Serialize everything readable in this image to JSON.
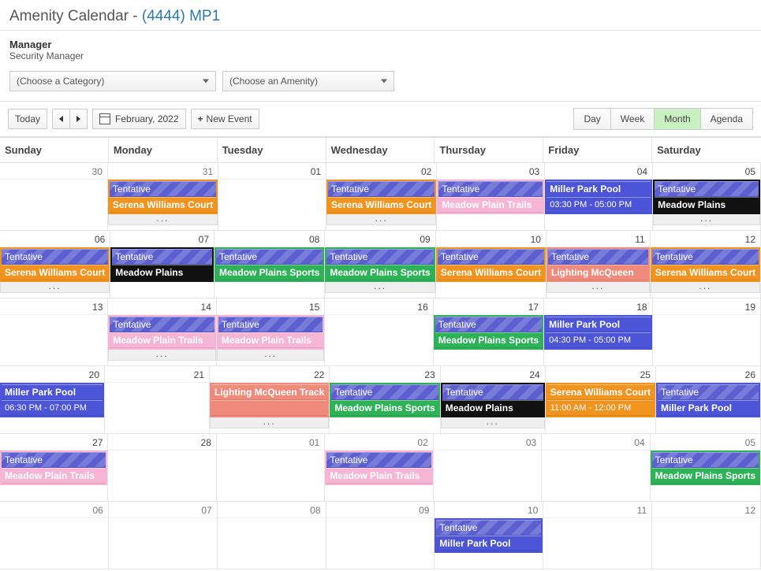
{
  "title_prefix": "Amenity Calendar - ",
  "title_link": "(4444) MP1",
  "manager_label": "Manager",
  "manager_value": "Security Manager",
  "filters": {
    "category_placeholder": "(Choose a Category)",
    "amenity_placeholder": "(Choose an Amenity)"
  },
  "toolbar": {
    "today_label": "Today",
    "period_label": "February, 2022",
    "new_event_label": "New Event",
    "views": {
      "day": "Day",
      "week": "Week",
      "month": "Month",
      "agenda": "Agenda"
    },
    "active_view": "Month"
  },
  "dow": [
    "Sunday",
    "Monday",
    "Tuesday",
    "Wednesday",
    "Thursday",
    "Friday",
    "Saturday"
  ],
  "labels": {
    "tentative": "Tentative",
    "more": "..."
  },
  "events": {
    "serena": "Serena Williams Court",
    "mp_trails": "Meadow Plain Trails",
    "mp_pool": "Miller Park Pool",
    "mp_plains": "Meadow Plains",
    "mp_sports": "Meadow Plains Sports",
    "lightning": "Lighting McQueen",
    "lightning_track": "Lighting McQueen Track",
    "pool_0330": "03:30 PM - 05:00 PM",
    "pool_0430": "04:30 PM - 05:00 PM",
    "pool_0630": "06:30 PM - 07:00 PM",
    "serena_1100": "11:00 AM - 12:00 PM"
  },
  "days": {
    "w1": [
      "30",
      "31",
      "01",
      "02",
      "03",
      "04",
      "05"
    ],
    "w2": [
      "06",
      "07",
      "08",
      "09",
      "10",
      "11",
      "12"
    ],
    "w3": [
      "13",
      "14",
      "15",
      "16",
      "17",
      "18",
      "19"
    ],
    "w4": [
      "20",
      "21",
      "22",
      "23",
      "24",
      "25",
      "26"
    ],
    "w5": [
      "27",
      "28",
      "01",
      "02",
      "03",
      "04",
      "05"
    ],
    "w6": [
      "06",
      "07",
      "08",
      "09",
      "10",
      "11",
      "12"
    ]
  }
}
